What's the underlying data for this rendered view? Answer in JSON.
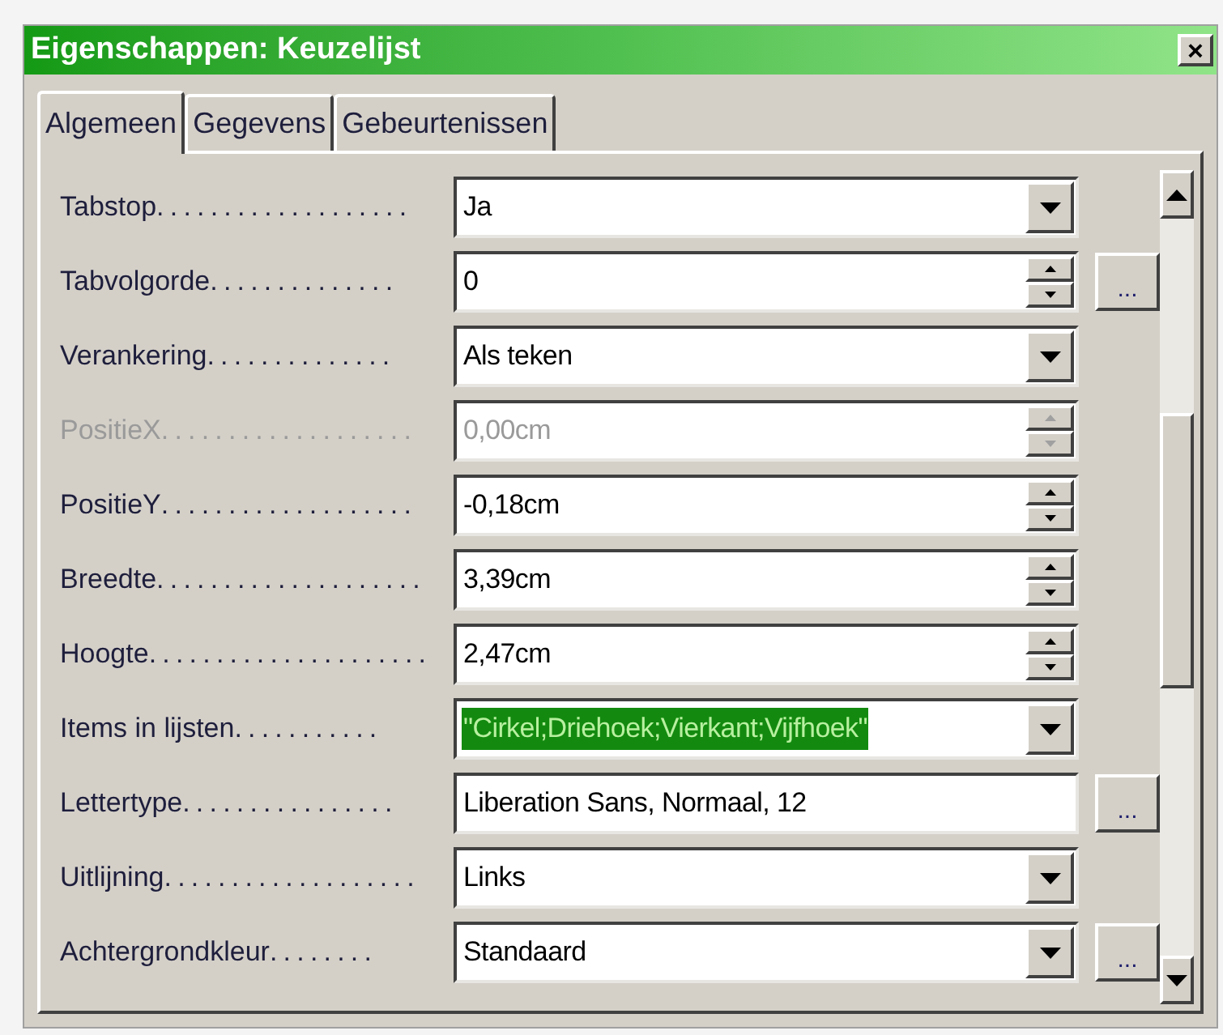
{
  "window": {
    "title": "Eigenschappen: Keuzelijst",
    "close": "×"
  },
  "tabs": [
    {
      "label": "Algemeen",
      "selected": true
    },
    {
      "label": "Gegevens",
      "selected": false
    },
    {
      "label": "Gebeurtenissen",
      "selected": false
    }
  ],
  "properties": [
    {
      "label": "Tabstop...................",
      "kind": "dropdown",
      "value": "Ja",
      "disabled": false,
      "highlighted": false
    },
    {
      "label": "Tabvolgorde..............",
      "kind": "spin",
      "value": "0",
      "disabled": false,
      "highlighted": false,
      "button": "..."
    },
    {
      "label": "Verankering..............",
      "kind": "dropdown",
      "value": "Als teken",
      "disabled": false,
      "highlighted": false
    },
    {
      "label": "PositieX...................",
      "kind": "spin",
      "value": "0,00cm",
      "disabled": true,
      "highlighted": false
    },
    {
      "label": "PositieY...................",
      "kind": "spin",
      "value": "-0,18cm",
      "disabled": false,
      "highlighted": false
    },
    {
      "label": "Breedte....................",
      "kind": "spin",
      "value": "3,39cm",
      "disabled": false,
      "highlighted": false
    },
    {
      "label": "Hoogte.....................",
      "kind": "spin",
      "value": "2,47cm",
      "disabled": false,
      "highlighted": false
    },
    {
      "label": "Items in lijsten...........",
      "kind": "dropdown",
      "value": "\"Cirkel;Driehoek;Vierkant;Vijfhoek\"",
      "disabled": false,
      "highlighted": true
    },
    {
      "label": "Lettertype................",
      "kind": "text",
      "value": "Liberation Sans, Normaal, 12",
      "disabled": false,
      "highlighted": false,
      "button": "..."
    },
    {
      "label": "Uitlijning...................",
      "kind": "dropdown",
      "value": "Links",
      "disabled": false,
      "highlighted": false
    },
    {
      "label": "Achtergrondkleur........",
      "kind": "dropdown",
      "value": "Standaard",
      "disabled": false,
      "highlighted": false,
      "button": "..."
    }
  ]
}
